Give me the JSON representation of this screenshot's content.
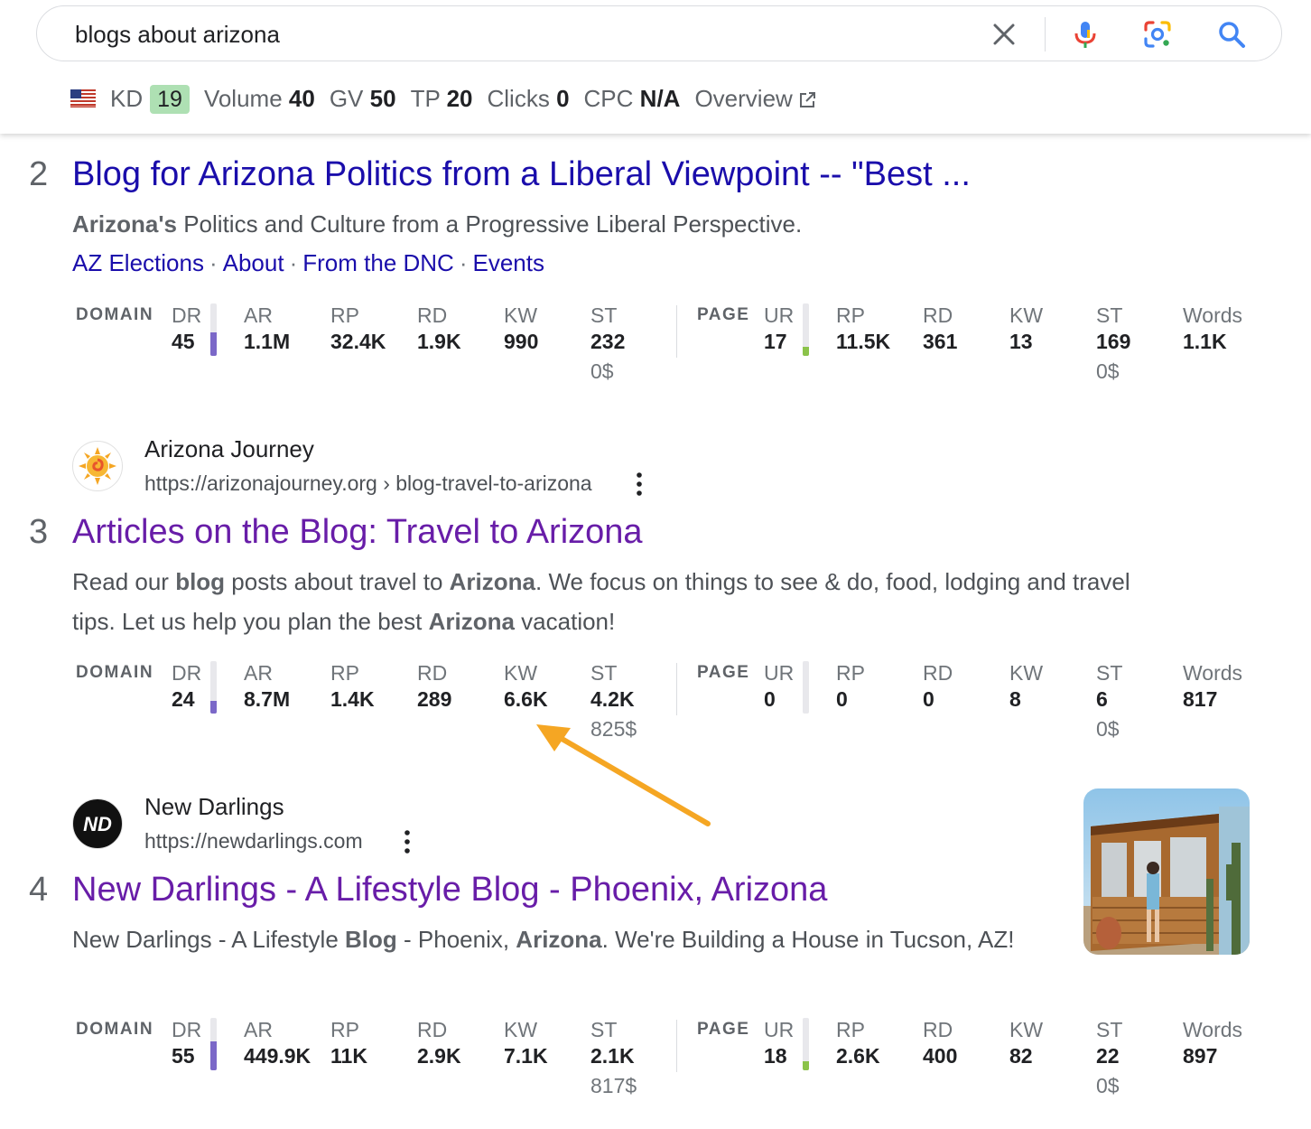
{
  "search": {
    "query": "blogs about arizona",
    "icons": [
      "clear-icon",
      "microphone-icon",
      "lens-icon",
      "search-icon"
    ]
  },
  "keyword_bar": {
    "kd_label": "KD",
    "kd_value": "19",
    "volume_label": "Volume",
    "volume_value": "40",
    "gv_label": "GV",
    "gv_value": "50",
    "tp_label": "TP",
    "tp_value": "20",
    "clicks_label": "Clicks",
    "clicks_value": "0",
    "cpc_label": "CPC",
    "cpc_value": "N/A",
    "overview_label": "Overview",
    "kd_color": "#aee0b3"
  },
  "metric_labels": {
    "domain": "DOMAIN",
    "page": "PAGE",
    "dr": "DR",
    "ar": "AR",
    "rp": "RP",
    "rd": "RD",
    "kw": "KW",
    "st": "ST",
    "ur": "UR",
    "words": "Words"
  },
  "results": [
    {
      "rank": "2",
      "title": "Blog for Arizona Politics from a Liberal Viewpoint -- \"Best ...",
      "snippet_bold": "Arizona's",
      "snippet_rest": " Politics and Culture from a Progressive Liberal Perspective.",
      "sitelinks": [
        "AZ Elections",
        "About",
        "From the DNC",
        "Events"
      ],
      "domain": {
        "dr": "45",
        "dr_fill": 0.45,
        "ar": "1.1M",
        "rp": "32.4K",
        "rd": "1.9K",
        "kw": "990",
        "st": "232",
        "st_cost": "0$"
      },
      "page": {
        "ur": "17",
        "ur_fill": 0.17,
        "rp": "11.5K",
        "rd": "361",
        "kw": "13",
        "st": "169",
        "st_cost": "0$",
        "words": "1.1K"
      }
    },
    {
      "rank": "3",
      "site_name": "Arizona Journey",
      "site_url": "https://arizonajourney.org › blog-travel-to-arizona",
      "title": "Articles on the Blog: Travel to Arizona",
      "snippet": {
        "p1": "Read our ",
        "b1": "blog",
        "p2": " posts about travel to ",
        "b2": "Arizona",
        "p3": ". We focus on things to see & do, food, lodging and travel tips. Let us help you plan the best ",
        "b3": "Arizona",
        "p4": " vacation!"
      },
      "domain": {
        "dr": "24",
        "dr_fill": 0.24,
        "ar": "8.7M",
        "rp": "1.4K",
        "rd": "289",
        "kw": "6.6K",
        "st": "4.2K",
        "st_cost": "825$"
      },
      "page": {
        "ur": "0",
        "ur_fill": 0,
        "rp": "0",
        "rd": "0",
        "kw": "8",
        "st": "6",
        "st_cost": "0$",
        "words": "817"
      }
    },
    {
      "rank": "4",
      "site_name": "New Darlings",
      "site_url": "https://newdarlings.com",
      "favicon_text": "ND",
      "title": "New Darlings - A Lifestyle Blog - Phoenix, Arizona",
      "snippet": {
        "p1": "New Darlings - A Lifestyle ",
        "b1": "Blog",
        "p2": " - Phoenix, ",
        "b2": "Arizona",
        "p3": ". We're Building a House in Tucson, AZ!"
      },
      "domain": {
        "dr": "55",
        "dr_fill": 0.55,
        "ar": "449.9K",
        "rp": "11K",
        "rd": "2.9K",
        "kw": "7.1K",
        "st": "2.1K",
        "st_cost": "817$"
      },
      "page": {
        "ur": "18",
        "ur_fill": 0.18,
        "rp": "2.6K",
        "rd": "400",
        "kw": "82",
        "st": "22",
        "st_cost": "0$",
        "words": "897"
      }
    }
  ],
  "colors": {
    "title_blue": "#1a0dab",
    "title_visited": "#681da8",
    "dr_bar": "#7b68c8",
    "ur_bar": "#8bc34a",
    "annotation_arrow": "#f5a623"
  }
}
